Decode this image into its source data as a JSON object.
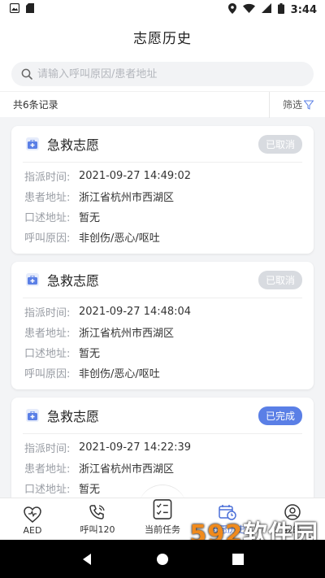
{
  "status_bar": {
    "time": "3:44"
  },
  "header": {
    "title": "志愿历史"
  },
  "search": {
    "placeholder": "请输入呼叫原因/患者地址",
    "value": ""
  },
  "filter": {
    "count_text": "共6条记录",
    "filter_label": "筛选"
  },
  "labels": {
    "dispatch_time": "指派时间:",
    "patient_address": "患者地址:",
    "verbal_address": "口述地址:",
    "call_reason": "呼叫原因:"
  },
  "cards": [
    {
      "title": "急救志愿",
      "status": "已取消",
      "dispatch_time": "2021-09-27 14:49:02",
      "patient_address": "浙江省杭州市西湖区",
      "verbal_address": "暂无",
      "call_reason": "非创伤/恶心/呕吐"
    },
    {
      "title": "急救志愿",
      "status": "已取消",
      "dispatch_time": "2021-09-27 14:48:04",
      "patient_address": "浙江省杭州市西湖区",
      "verbal_address": "暂无",
      "call_reason": "非创伤/恶心/呕吐"
    },
    {
      "title": "急救志愿",
      "status": "已完成",
      "dispatch_time": "2021-09-27 14:22:39",
      "patient_address": "浙江省杭州市西湖区",
      "verbal_address": "暂无",
      "call_reason": ""
    }
  ],
  "bottom_nav": [
    {
      "label": "AED",
      "icon": "heart-pulse-icon"
    },
    {
      "label": "呼叫120",
      "icon": "phone-icon"
    },
    {
      "label": "当前任务",
      "icon": "checklist-icon"
    },
    {
      "label": "志愿历史",
      "icon": "calendar-clock-icon"
    },
    {
      "label": "我的",
      "icon": "user-icon"
    }
  ],
  "watermark": {
    "brand": "592软件园",
    "url": "www.592xiazai.com"
  },
  "colors": {
    "accent": "#4a6fd8",
    "done_badge": "#5a7fe6",
    "cancel_badge": "#d8dbe0"
  }
}
